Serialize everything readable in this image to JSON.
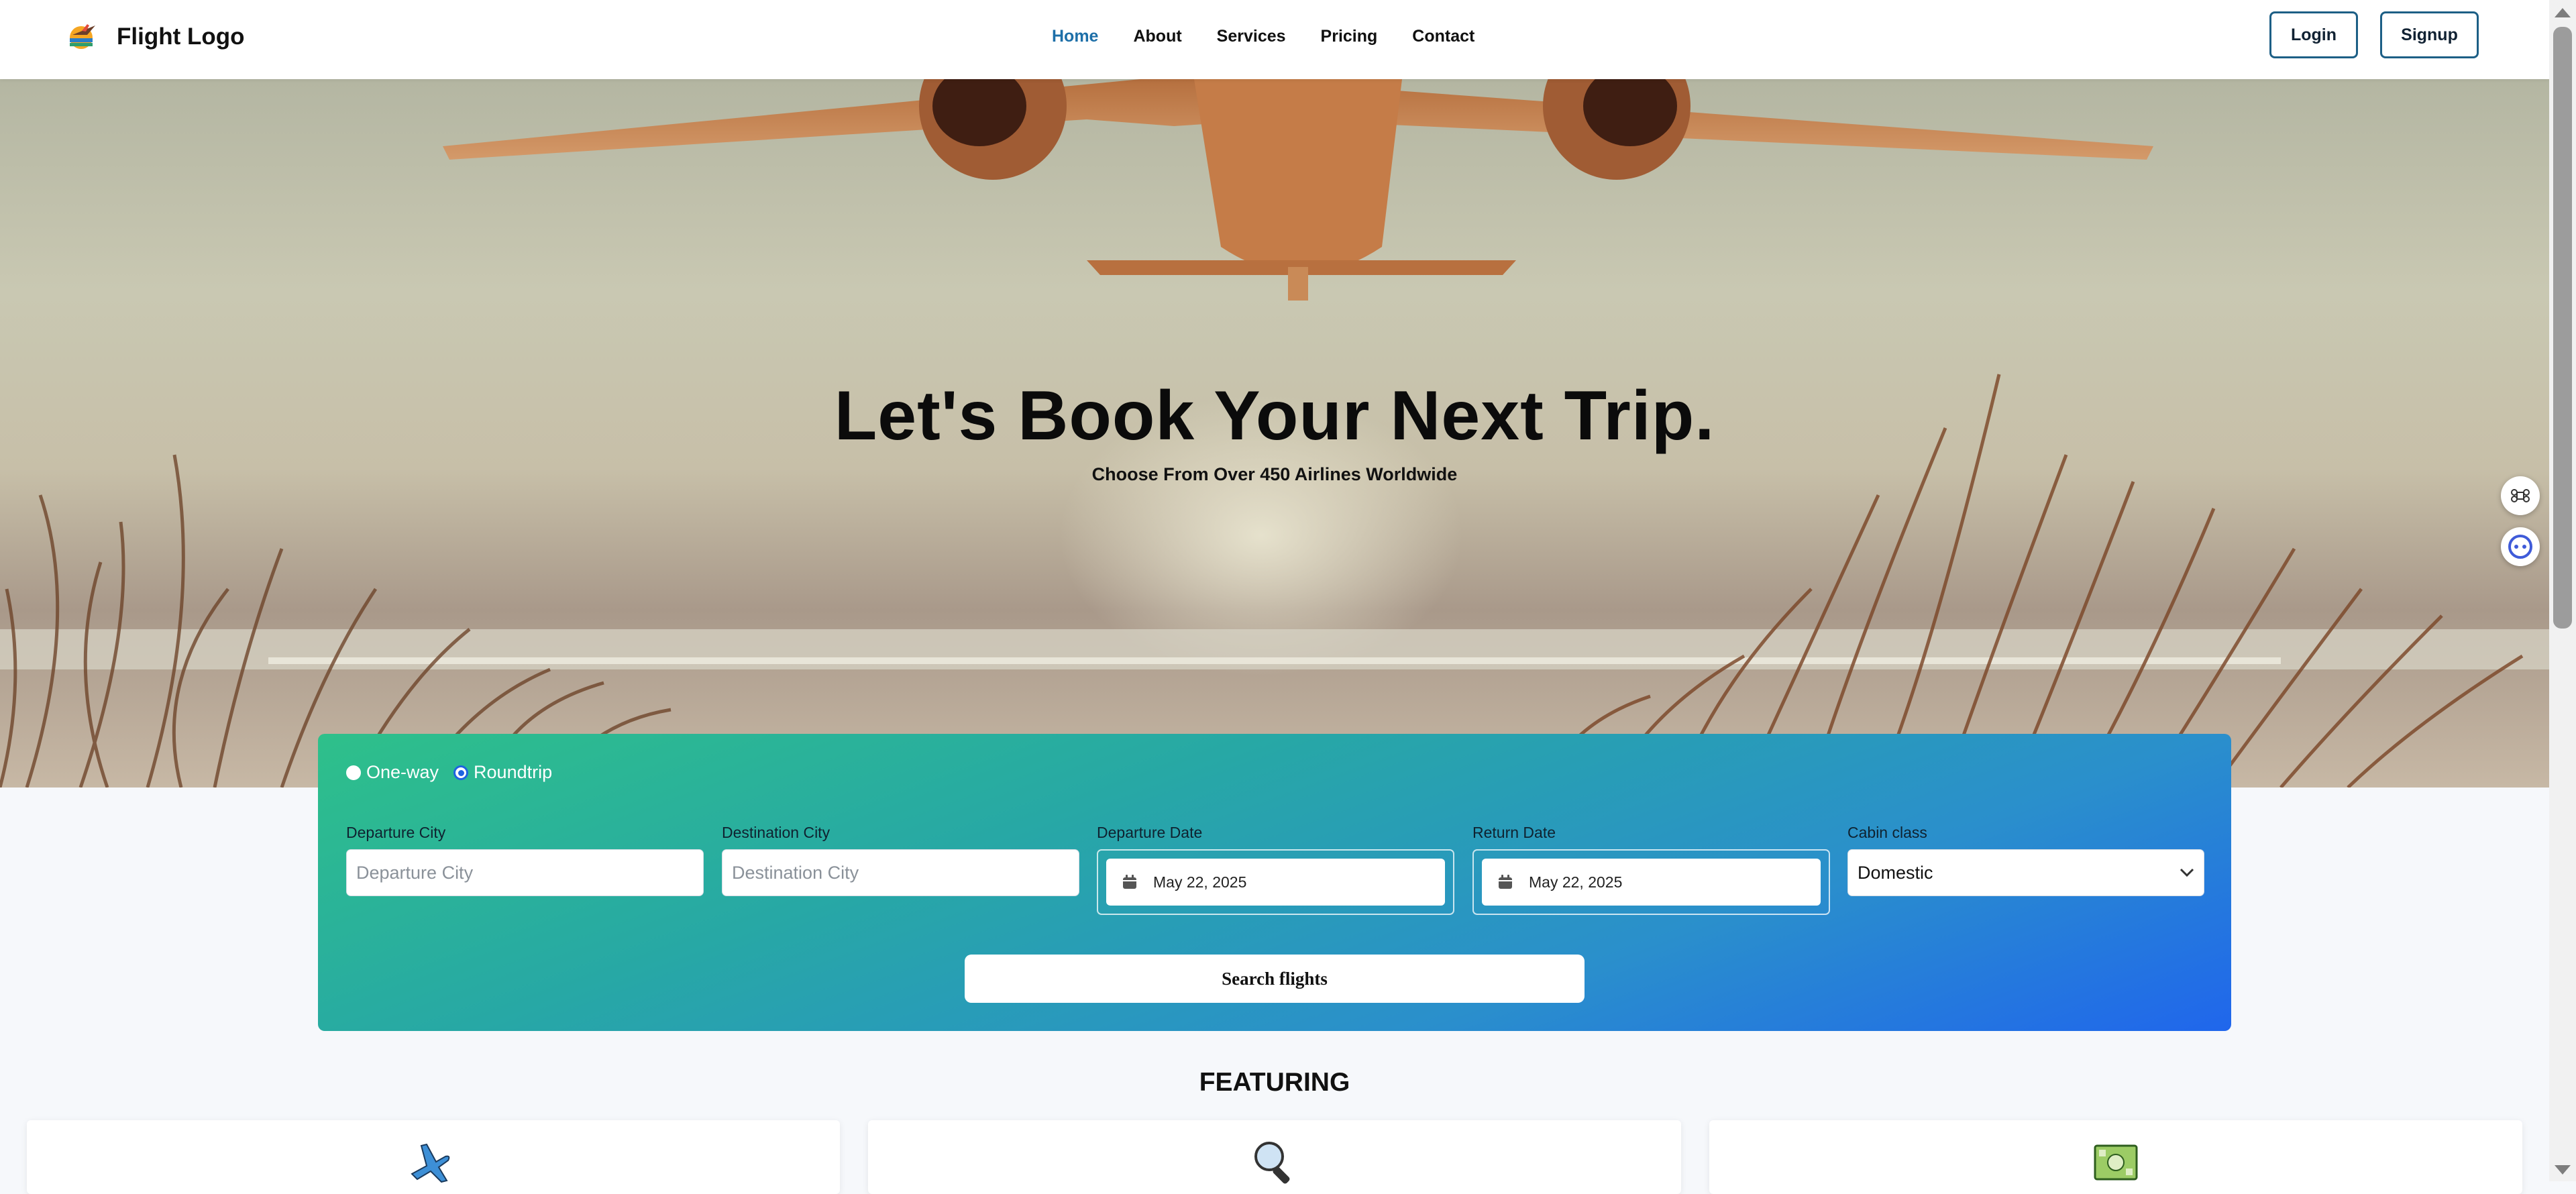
{
  "header": {
    "logo_text": "Flight Logo",
    "nav": [
      {
        "label": "Home",
        "active": true
      },
      {
        "label": "About",
        "active": false
      },
      {
        "label": "Services",
        "active": false
      },
      {
        "label": "Pricing",
        "active": false
      },
      {
        "label": "Contact",
        "active": false
      }
    ],
    "login_label": "Login",
    "signup_label": "Signup"
  },
  "hero": {
    "title": "Let's Book Your Next Trip.",
    "subtitle": "Choose From Over 450 Airlines Worldwide"
  },
  "search": {
    "trip_options": [
      {
        "label": "One-way",
        "selected": false
      },
      {
        "label": "Roundtrip",
        "selected": true
      }
    ],
    "departure_city": {
      "label": "Departure City",
      "placeholder": "Departure City",
      "value": ""
    },
    "destination_city": {
      "label": "Destination City",
      "placeholder": "Destination City",
      "value": ""
    },
    "departure_date": {
      "label": "Departure Date",
      "value": "May 22, 2025"
    },
    "return_date": {
      "label": "Return Date",
      "value": "May 22, 2025"
    },
    "cabin_class": {
      "label": "Cabin class",
      "value": "Domestic"
    },
    "submit_label": "Search flights"
  },
  "featuring": {
    "title": "FEATURING",
    "cards": [
      {
        "icon": "airplane-icon"
      },
      {
        "icon": "magnifier-icon"
      },
      {
        "icon": "money-icon"
      }
    ]
  },
  "colors": {
    "nav_active": "#1d6fa8",
    "panel_gradient_start": "#2ec08a",
    "panel_gradient_end": "#2066ec",
    "auth_border": "#1d5f86"
  },
  "widgets": [
    "command-icon",
    "assistant-icon"
  ]
}
